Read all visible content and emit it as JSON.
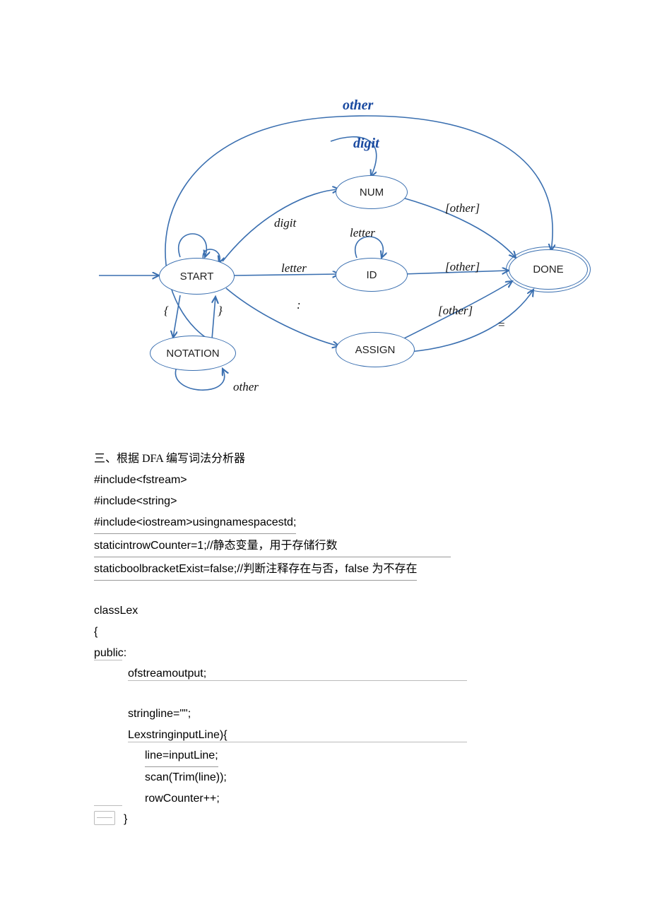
{
  "diagram": {
    "states": {
      "start": "START",
      "notation": "NOTATION",
      "num": "NUM",
      "id": "ID",
      "assign": "ASSIGN",
      "done": "DONE"
    },
    "labels": {
      "top_other": "other",
      "top_digit": "digit",
      "digit": "digit",
      "letter_to_id": "letter",
      "letter_loop": "letter",
      "colon": ":",
      "open_brace": "{",
      "close_brace": "}",
      "num_other": "[other]",
      "id_other": "[other]",
      "assign_other": "[other]",
      "eq": "=",
      "notation_other": "other"
    }
  },
  "section_title": "三、根据 DFA 编写词法分析器",
  "code": {
    "l1": "#include<fstream>",
    "l2": "#include<string>",
    "l3": "#include<iostream>usingnamespacestd;",
    "l4": "staticintrowCounter=1;//静态变量，用于存储行数",
    "l5": "staticboolbracketExist=false;//判断注释存在与否，false 为不存在",
    "l6": "classLex",
    "l7": "{",
    "l8": "public:",
    "l9": "ofstreamoutput;",
    "l10": "stringline=\"\";",
    "l11": "LexstringinputLine){",
    "l12": "line=inputLine;",
    "l13": "scan(Trim(line));",
    "l14": "rowCounter++;",
    "l15": "}"
  }
}
